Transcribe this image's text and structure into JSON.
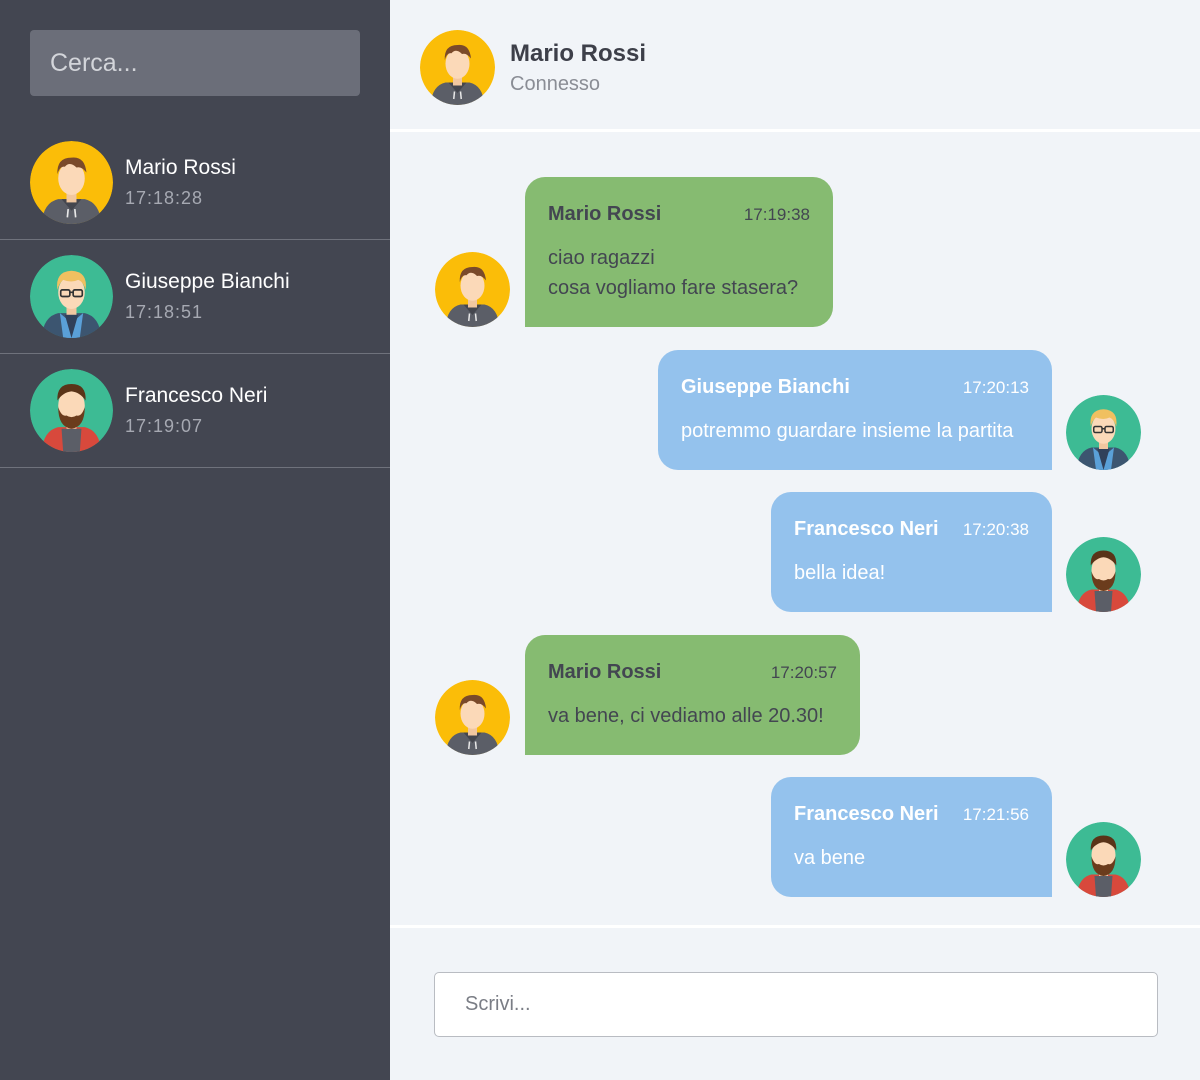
{
  "sidebar": {
    "search": {
      "placeholder": "Cerca...",
      "value": ""
    },
    "contacts": [
      {
        "name": "Mario Rossi",
        "time": "17:18:28",
        "avatar": "avatar-mario-icon",
        "avatar_bg": "#fbbd08"
      },
      {
        "name": "Giuseppe Bianchi",
        "time": "17:18:51",
        "avatar": "avatar-giuseppe-icon",
        "avatar_bg": "#3dbb94"
      },
      {
        "name": "Francesco Neri",
        "time": "17:19:07",
        "avatar": "avatar-francesco-icon",
        "avatar_bg": "#3dbb94"
      }
    ]
  },
  "header": {
    "name": "Mario Rossi",
    "status": "Connesso",
    "avatar": "avatar-mario-icon"
  },
  "messages": [
    {
      "sender": "Mario Rossi",
      "time": "17:19:38",
      "text": "ciao ragazzi\ncosa vogliamo fare stasera?",
      "side": "left",
      "color": "#86bb71"
    },
    {
      "sender": "Giuseppe Bianchi",
      "time": "17:20:13",
      "text": "potremmo guardare insieme la partita",
      "side": "right",
      "color": "#94c2ed"
    },
    {
      "sender": "Francesco Neri",
      "time": "17:20:38",
      "text": "bella idea!",
      "side": "right",
      "color": "#94c2ed"
    },
    {
      "sender": "Mario Rossi",
      "time": "17:20:57",
      "text": "va bene, ci vediamo alle 20.30!",
      "side": "left",
      "color": "#86bb71"
    },
    {
      "sender": "Francesco Neri",
      "time": "17:21:56",
      "text": "va bene",
      "side": "right",
      "color": "#94c2ed"
    }
  ],
  "composer": {
    "placeholder": "Scrivi...",
    "value": ""
  },
  "colors": {
    "sidebar_bg": "#434651",
    "chat_bg": "#f1f4f8",
    "bubble_sent_by_mario": "#86bb71",
    "bubble_others": "#94c2ed"
  }
}
